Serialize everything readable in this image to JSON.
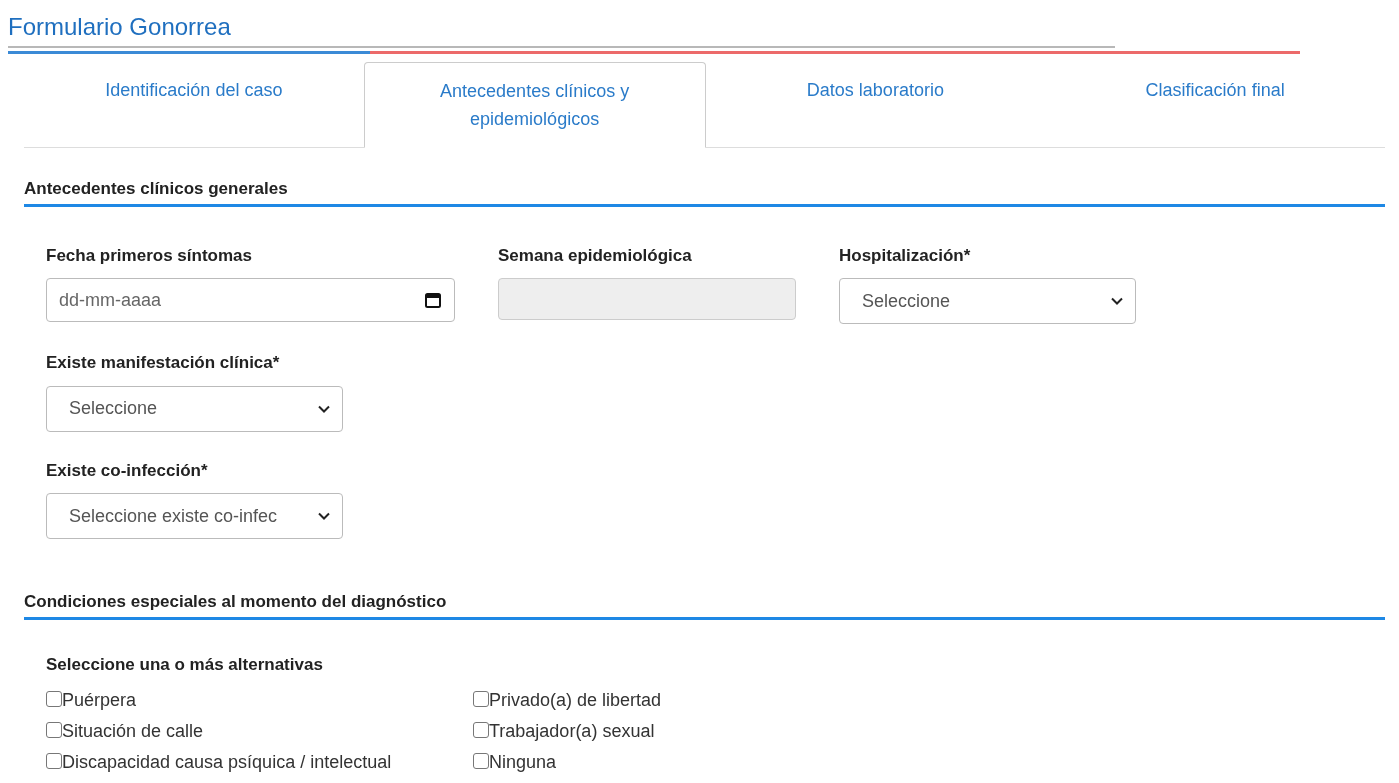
{
  "title": "Formulario Gonorrea",
  "tabs": [
    {
      "label": "Identificación del caso",
      "selected": false
    },
    {
      "label": "Antecedentes clínicos y epidemiológicos",
      "selected": true
    },
    {
      "label": "Datos laboratorio",
      "selected": false
    },
    {
      "label": "Clasificación final",
      "selected": false
    }
  ],
  "section_1": {
    "title": "Antecedentes clínicos generales",
    "rows": [
      [
        {
          "label": "Fecha primeros síntomas",
          "kind": "date",
          "placeholder": "dd-mm-aaaa"
        },
        {
          "label": "Semana epidemiológica",
          "kind": "readonly"
        },
        {
          "label": "Hospitalización*",
          "kind": "select",
          "value": "Seleccione"
        }
      ],
      [
        {
          "label": "Existe manifestación clínica*",
          "kind": "select",
          "value": "Seleccione"
        }
      ],
      [
        {
          "label": "Existe co-infección*",
          "kind": "select",
          "value": "Seleccione existe co-infec"
        }
      ]
    ]
  },
  "section_2": {
    "title": "Condiciones especiales al momento del diagnóstico",
    "subtitle": "Seleccione una o más alternativas",
    "options": [
      {
        "label": "Puérpera",
        "checked": false
      },
      {
        "label": "Situación de calle",
        "checked": false
      },
      {
        "label": "Discapacidad causa psíquica / intelectual",
        "checked": false
      },
      {
        "label": "Privado(a) de libertad",
        "checked": false
      },
      {
        "label": "Trabajador(a) sexual",
        "checked": false
      },
      {
        "label": "Ninguna",
        "checked": false
      }
    ]
  }
}
